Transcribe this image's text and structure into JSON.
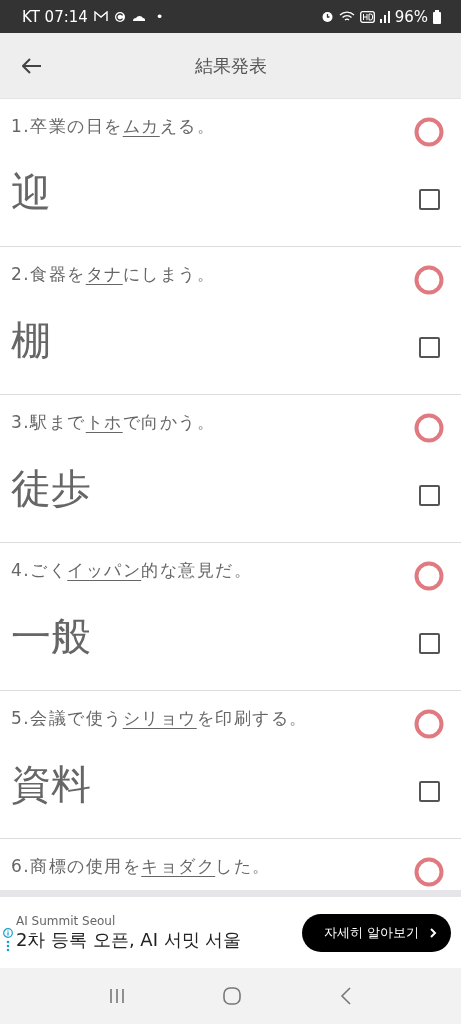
{
  "status_bar": {
    "carrier_time": "KT 07:14",
    "dot": "•",
    "battery": "96%"
  },
  "header": {
    "title": "結果発表"
  },
  "questions": [
    {
      "number": "1.",
      "before": "卒業の日を",
      "underlined": "ムカ",
      "after": "える。",
      "answer": "迎",
      "checked": false
    },
    {
      "number": "2.",
      "before": "食器を",
      "underlined": "タナ",
      "after": "にしまう。",
      "answer": "棚",
      "checked": false
    },
    {
      "number": "3.",
      "before": "駅まで",
      "underlined": "トホ",
      "after": "で向かう。",
      "answer": "徒歩",
      "checked": false
    },
    {
      "number": "4.",
      "before": "ごく",
      "underlined": "イッパン",
      "after": "的な意見だ。",
      "answer": "一般",
      "checked": false
    },
    {
      "number": "5.",
      "before": "会議で使う",
      "underlined": "シリョウ",
      "after": "を印刷する。",
      "answer": "資料",
      "checked": false
    },
    {
      "number": "6.",
      "before": "商標の使用を",
      "underlined": "キョダク",
      "after": "した。"
    }
  ],
  "ad": {
    "advertiser": "AI Summit Seoul",
    "headline": "2차 등록 오픈, AI 서밋 서울",
    "button": "자세히 알아보기"
  }
}
